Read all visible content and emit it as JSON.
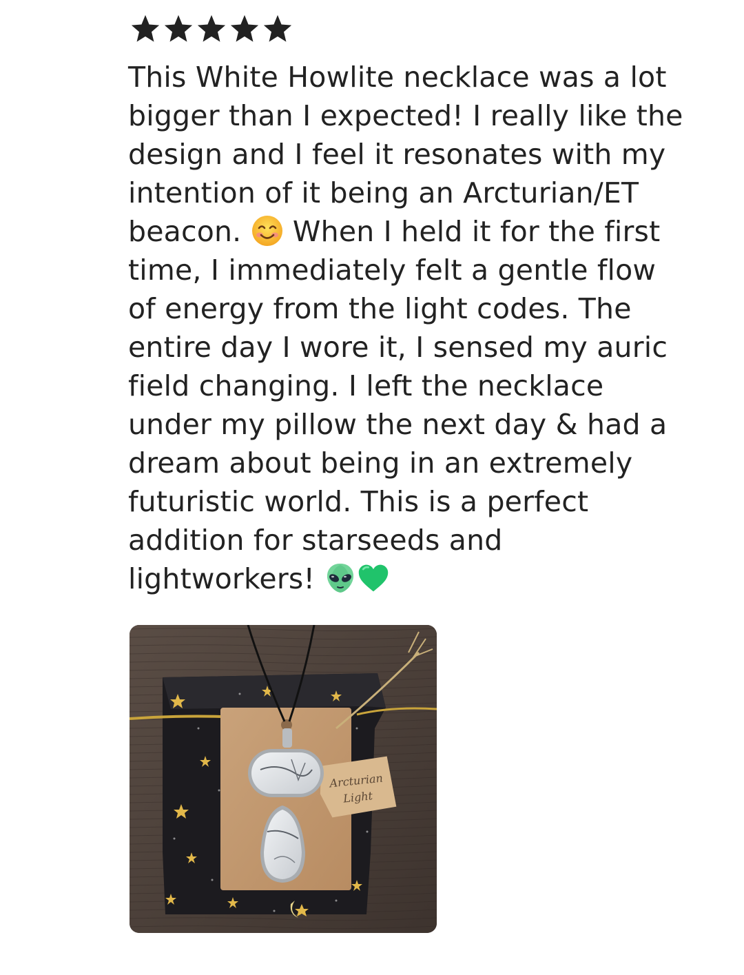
{
  "review": {
    "rating": 5,
    "rating_max": 5,
    "star_icon": "star-icon",
    "star_color": "#222222",
    "text_lines": [
      "This White Howlite necklace was a lot",
      "bigger than I expected! I really like the",
      "design and I feel it resonates with my",
      "intention of it being an Arcturian/ET"
    ],
    "line5_before": "beacon.",
    "line5_emoji": "smiling-face-emoji",
    "line5_after": "When I held it for the first",
    "text_lines_2": [
      "time, I immediately felt a gentle flow",
      "of energy from the light codes. The",
      "entire day I wore it, I sensed my auric",
      "field changing. I left the necklace",
      "under my pillow the next day & had a",
      "dream about being in an extremely",
      "futuristic world. This is a perfect",
      "addition for starseeds and"
    ],
    "last_line": "lightworkers!",
    "last_emojis": [
      "alien-emoji",
      "green-heart-emoji"
    ],
    "photo": {
      "description_icon": "review-photo",
      "tag_text_line1": "Arcturian",
      "tag_text_line2": "Light"
    }
  }
}
